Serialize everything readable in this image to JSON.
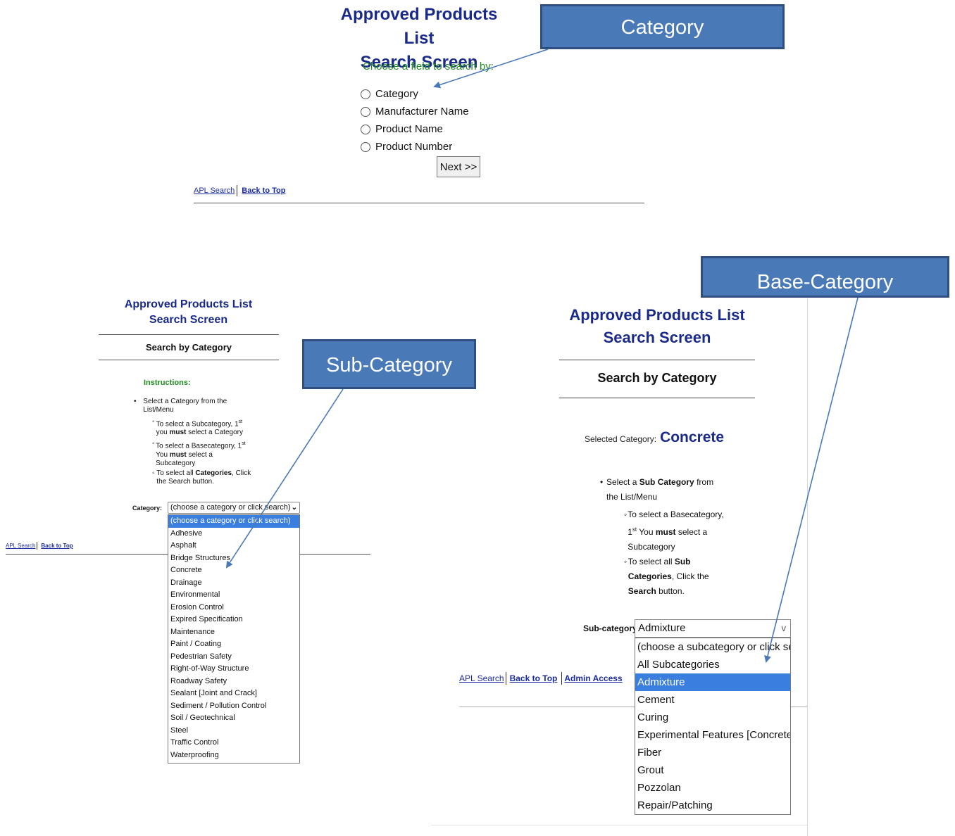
{
  "panel1": {
    "title_line1": "Approved Products List",
    "title_line2": "Search Screen",
    "prompt": "Choose a field to search by:",
    "options": [
      "Category",
      "Manufacturer Name",
      "Product Name",
      "Product Number"
    ],
    "next_button": "Next >>",
    "links": {
      "apl_search": "APL Search",
      "back_to_top": "Back to Top"
    }
  },
  "panel2": {
    "title_line1": "Approved Products List",
    "title_line2": "Search Screen",
    "section": "Search by Category",
    "instructions_heading": "Instructions:",
    "bullet1": "Select a Category from the List/Menu",
    "sub1_a": "To select a Subcategory, 1",
    "sub1_sup": "st",
    "sub1_b": "you ",
    "sub1_must": "must",
    "sub1_c": " select a Category",
    "sub2_a": "To select a Basecategory, 1",
    "sub2_sup": "st",
    "sub2_b": "You ",
    "sub2_must": "must",
    "sub2_c": " select a Subcategory",
    "sub3_a": "To select all ",
    "sub3_bold": "Categories",
    "sub3_b": ", Click the Search button.",
    "category_label": "Category:",
    "select_value": "(choose a category or click search)",
    "dropdown_options": [
      "(choose a category or click search)",
      "Adhesive",
      "Asphalt",
      "Bridge Structures",
      "Concrete",
      "Drainage",
      "Environmental",
      "Erosion Control",
      "Expired Specification",
      "Maintenance",
      "Paint / Coating",
      "Pedestrian Safety",
      "Right-of-Way Structure",
      "Roadway Safety",
      "Sealant [Joint and Crack]",
      "Sediment / Pollution Control",
      "Soil / Geotechnical",
      "Steel",
      "Traffic Control",
      "Waterproofing"
    ],
    "links": {
      "apl_search": "APL Search",
      "back_to_top": "Back to Top"
    }
  },
  "panel3": {
    "title_line1": "Approved Products List",
    "title_line2": "Search Screen",
    "section": "Search by Category",
    "selected_label": "Selected Category:",
    "selected_value": "Concrete",
    "bullet1_a": "Select a ",
    "bullet1_bold": "Sub Category",
    "bullet1_b": " from the List/Menu",
    "sub1_a": "To select a Basecategory, 1",
    "sub1_sup": "st",
    "sub1_b": "You ",
    "sub1_must": "must",
    "sub1_c": " select a Subcategory",
    "sub2_a": "To select all ",
    "sub2_bold": "Sub Categories",
    "sub2_b": ", Click the ",
    "sub2_search": "Search",
    "sub2_c": " button.",
    "subcategory_label": "Sub-category:",
    "select_value": "Admixture",
    "dropdown_options": [
      "(choose a subcategory or click search)",
      "All Subcategories",
      "Admixture",
      "Cement",
      "Curing",
      "Experimental Features [Concrete]",
      "Fiber",
      "Grout",
      "Pozzolan",
      "Repair/Patching"
    ],
    "links": {
      "apl_search": "APL Search",
      "back_to_top": "Back to Top",
      "admin_access": "Admin Access"
    }
  },
  "callouts": {
    "category": "Category",
    "sub_category": "Sub-Category",
    "base_category": "Base-Category"
  },
  "colors": {
    "callout_fill": "#4a79b8",
    "title": "#1a2a8a",
    "prompt_green": "#1f8a1f",
    "highlight": "#3a7fe0"
  }
}
